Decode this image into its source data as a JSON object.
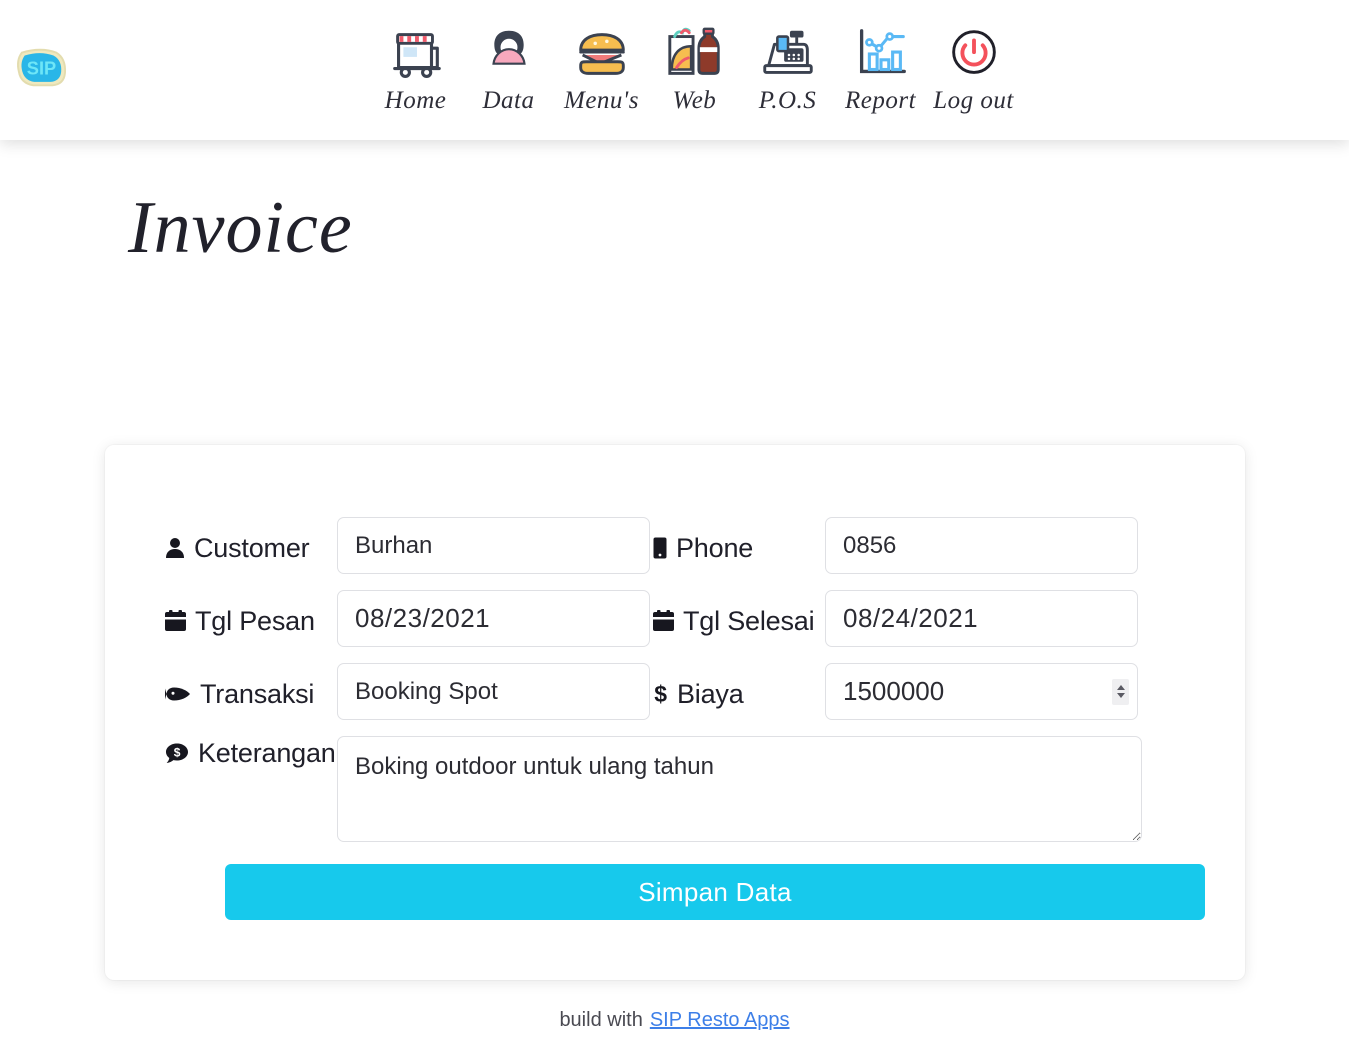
{
  "brand": {
    "logo_text": "SIP",
    "alt": "sip-logo"
  },
  "nav": {
    "items": [
      {
        "label": "Home",
        "icon": "food-truck-icon"
      },
      {
        "label": "Data",
        "icon": "user-avatar-icon"
      },
      {
        "label": "Menu's",
        "icon": "burger-icon"
      },
      {
        "label": "Web",
        "icon": "taco-soda-icon"
      },
      {
        "label": "P.O.S",
        "icon": "cash-register-icon"
      },
      {
        "label": "Report",
        "icon": "bar-line-chart-icon"
      },
      {
        "label": "Log out",
        "icon": "power-button-icon"
      }
    ]
  },
  "page": {
    "title": "Invoice"
  },
  "form": {
    "customer": {
      "label": "Customer",
      "icon": "user-icon",
      "value": "Burhan"
    },
    "phone": {
      "label": "Phone",
      "icon": "mobile-phone-icon",
      "value": "0856"
    },
    "tgl_pesan": {
      "label": "Tgl Pesan",
      "icon": "calendar-icon",
      "value": "08/23/2021"
    },
    "tgl_selesai": {
      "label": "Tgl Selesai",
      "icon": "calendar-icon",
      "value": "08/24/2021"
    },
    "transaksi": {
      "label": "Transaksi",
      "icon": "fish-icon",
      "value": "Booking Spot"
    },
    "biaya": {
      "label": "Biaya",
      "icon": "dollar-sign-icon",
      "value": "1500000"
    },
    "keterangan": {
      "label": "Keterangan",
      "icon": "comment-dollar-icon",
      "value": "Boking outdoor untuk ulang tahun"
    },
    "submit": {
      "label": "Simpan Data"
    }
  },
  "footer": {
    "text": "build with",
    "link_label": "SIP Resto Apps"
  },
  "colors": {
    "accent": "#17c9ec",
    "link": "#3d7fe8",
    "text": "#20202a",
    "border": "#dfe0e4",
    "icon_dark": "#3b4250",
    "icon_blue": "#5ab9f5",
    "icon_pink": "#f7a8bd",
    "icon_red": "#f4515b",
    "icon_yellow": "#f6bd4f"
  }
}
